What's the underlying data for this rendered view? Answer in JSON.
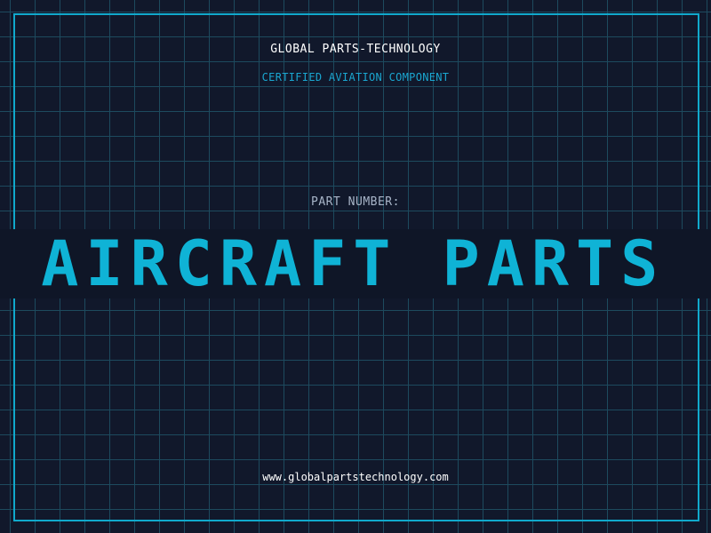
{
  "header": {
    "brand": "GLOBAL PARTS-TECHNOLOGY",
    "subtitle": "CERTIFIED AVIATION COMPONENT"
  },
  "part": {
    "label": "PART NUMBER:",
    "marquee_text": "P AIRCRAFT PARTS D"
  },
  "footer": {
    "url": "www.globalpartstechnology.com"
  },
  "colors": {
    "background": "#11182b",
    "grid": "#1d4a5e",
    "accent": "#10a9cc",
    "text": "#ffffff"
  }
}
